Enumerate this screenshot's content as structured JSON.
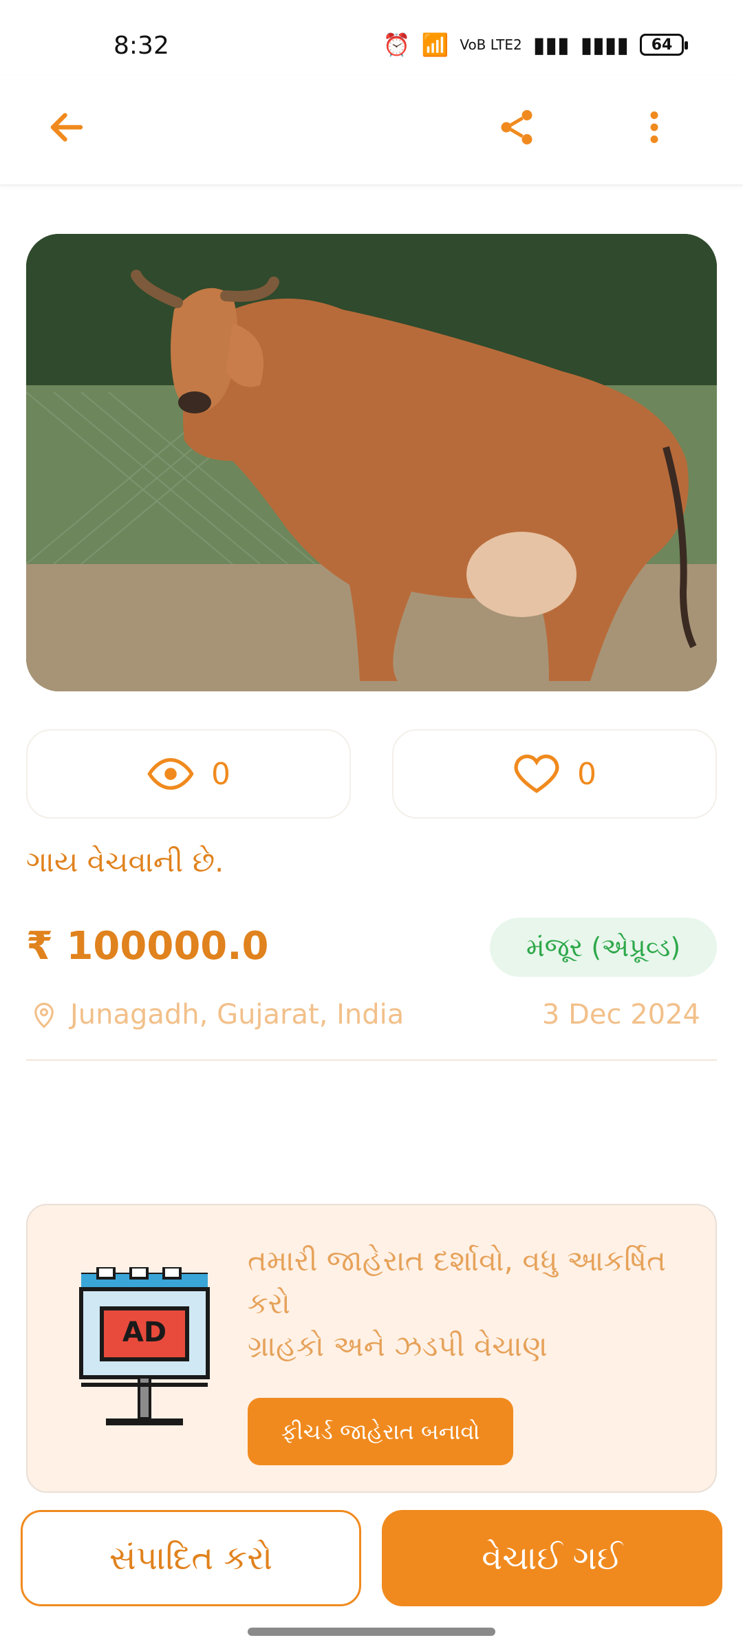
{
  "status_bar": {
    "time": "8:32",
    "signal_text": "VoB LTE2",
    "battery": "64"
  },
  "app_bar": {
    "back_icon": "arrow-left-icon",
    "share_icon": "share-icon",
    "more_icon": "more-vert-icon"
  },
  "listing": {
    "image_alt": "Red Gir cow standing on dirt ground",
    "views": "0",
    "likes": "0",
    "title": "ગાય વેચવાની છે.",
    "price": "₹ 100000.0",
    "status_badge": "મંજૂર (એપ્રૂવ્ડ)",
    "location": "Junagadh, Gujarat, India",
    "date": "3 Dec 2024"
  },
  "promo": {
    "line1": "તમારી જાહેરાત દર્શાવો, વધુ આકર્ષિત કરો",
    "line2": "ગ્રાહકો અને ઝડપી વેચાણ",
    "button": "ફીચર્ડ જાહેરાત બનાવો",
    "icon": "billboard-ad-icon",
    "icon_text": "AD"
  },
  "bottom_actions": {
    "edit_label": "સંપાદિત કરો",
    "sold_label": "વેચાઈ ગઈ"
  },
  "colors": {
    "accent": "#f08a1e",
    "approved_green": "#2ea84a",
    "promo_bg": "#fff1e6"
  }
}
